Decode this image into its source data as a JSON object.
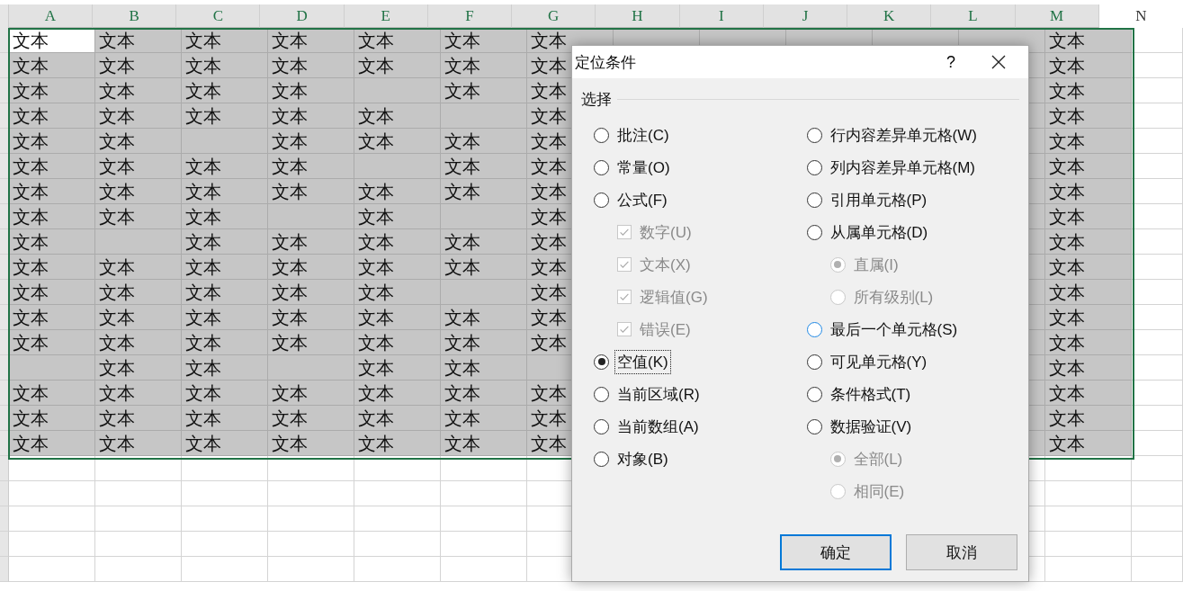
{
  "sheet": {
    "active_cell_at_origin": true,
    "columns": [
      {
        "label": "A",
        "selected": true
      },
      {
        "label": "B",
        "selected": true
      },
      {
        "label": "C",
        "selected": true
      },
      {
        "label": "D",
        "selected": true
      },
      {
        "label": "E",
        "selected": true
      },
      {
        "label": "F",
        "selected": true
      },
      {
        "label": "G",
        "selected": true
      },
      {
        "label": "H",
        "selected": true
      },
      {
        "label": "I",
        "selected": true
      },
      {
        "label": "J",
        "selected": true
      },
      {
        "label": "K",
        "selected": true
      },
      {
        "label": "L",
        "selected": true
      },
      {
        "label": "M",
        "selected": true
      },
      {
        "label": "N",
        "selected": false
      }
    ],
    "rows": [
      [
        "文本",
        "文本",
        "文本",
        "文本",
        "文本",
        "文本",
        "文本",
        null,
        null,
        null,
        null,
        null,
        "文本"
      ],
      [
        "文本",
        "文本",
        "文本",
        "文本",
        "文本",
        "文本",
        "文本",
        null,
        null,
        null,
        null,
        null,
        "文本"
      ],
      [
        "文本",
        "文本",
        "文本",
        "文本",
        null,
        "文本",
        "文本",
        null,
        null,
        null,
        null,
        null,
        "文本"
      ],
      [
        "文本",
        "文本",
        "文本",
        "文本",
        "文本",
        null,
        "文本",
        null,
        null,
        null,
        null,
        null,
        "文本"
      ],
      [
        "文本",
        "文本",
        null,
        "文本",
        "文本",
        "文本",
        "文本",
        null,
        null,
        null,
        null,
        null,
        "文本"
      ],
      [
        "文本",
        "文本",
        "文本",
        "文本",
        null,
        "文本",
        "文本",
        null,
        null,
        null,
        null,
        null,
        "文本"
      ],
      [
        "文本",
        "文本",
        "文本",
        "文本",
        "文本",
        "文本",
        "文本",
        null,
        null,
        null,
        null,
        null,
        "文本"
      ],
      [
        "文本",
        "文本",
        "文本",
        null,
        "文本",
        null,
        "文本",
        null,
        null,
        null,
        null,
        null,
        "文本"
      ],
      [
        "文本",
        null,
        "文本",
        "文本",
        "文本",
        "文本",
        "文本",
        null,
        null,
        null,
        null,
        null,
        "文本"
      ],
      [
        "文本",
        "文本",
        "文本",
        "文本",
        "文本",
        "文本",
        "文本",
        null,
        null,
        null,
        null,
        null,
        "文本"
      ],
      [
        "文本",
        "文本",
        "文本",
        "文本",
        "文本",
        null,
        "文本",
        null,
        null,
        null,
        null,
        null,
        "文本"
      ],
      [
        "文本",
        "文本",
        "文本",
        "文本",
        "文本",
        "文本",
        "文本",
        null,
        null,
        null,
        null,
        null,
        "文本"
      ],
      [
        "文本",
        "文本",
        "文本",
        "文本",
        "文本",
        "文本",
        "文本",
        null,
        null,
        null,
        null,
        null,
        "文本"
      ],
      [
        null,
        "文本",
        "文本",
        null,
        "文本",
        "文本",
        null,
        null,
        null,
        null,
        null,
        null,
        "文本"
      ],
      [
        "文本",
        "文本",
        "文本",
        "文本",
        "文本",
        "文本",
        "文本",
        null,
        null,
        null,
        null,
        null,
        "文本"
      ],
      [
        "文本",
        "文本",
        "文本",
        "文本",
        "文本",
        "文本",
        "文本",
        null,
        null,
        null,
        null,
        null,
        "文本"
      ],
      [
        "文本",
        "文本",
        "文本",
        "文本",
        "文本",
        "文本",
        "文本",
        null,
        null,
        null,
        null,
        null,
        "文本"
      ]
    ]
  },
  "dialog": {
    "title": "定位条件",
    "help": "?",
    "group_label": "选择",
    "left_options": [
      {
        "kind": "radio",
        "label": "批注(C)",
        "selected": false,
        "disabled": false,
        "focused": false,
        "hovered": false
      },
      {
        "kind": "radio",
        "label": "常量(O)",
        "selected": false,
        "disabled": false,
        "focused": false,
        "hovered": false
      },
      {
        "kind": "radio",
        "label": "公式(F)",
        "selected": false,
        "disabled": false,
        "focused": false,
        "hovered": false,
        "children": [
          {
            "kind": "checkbox",
            "label": "数字(U)",
            "checked": true,
            "disabled": true,
            "focused": false
          },
          {
            "kind": "checkbox",
            "label": "文本(X)",
            "checked": true,
            "disabled": true,
            "focused": false
          },
          {
            "kind": "checkbox",
            "label": "逻辑值(G)",
            "checked": true,
            "disabled": true,
            "focused": false
          },
          {
            "kind": "checkbox",
            "label": "错误(E)",
            "checked": true,
            "disabled": true,
            "focused": false
          }
        ]
      },
      {
        "kind": "radio",
        "label": "空值(K)",
        "selected": true,
        "disabled": false,
        "focused": true,
        "hovered": false
      },
      {
        "kind": "radio",
        "label": "当前区域(R)",
        "selected": false,
        "disabled": false,
        "focused": false,
        "hovered": false
      },
      {
        "kind": "radio",
        "label": "当前数组(A)",
        "selected": false,
        "disabled": false,
        "focused": false,
        "hovered": false
      },
      {
        "kind": "radio",
        "label": "对象(B)",
        "selected": false,
        "disabled": false,
        "focused": false,
        "hovered": false
      }
    ],
    "right_options": [
      {
        "kind": "radio",
        "label": "行内容差异单元格(W)",
        "selected": false,
        "disabled": false,
        "focused": false,
        "hovered": false
      },
      {
        "kind": "radio",
        "label": "列内容差异单元格(M)",
        "selected": false,
        "disabled": false,
        "focused": false,
        "hovered": false
      },
      {
        "kind": "radio",
        "label": "引用单元格(P)",
        "selected": false,
        "disabled": false,
        "focused": false,
        "hovered": false
      },
      {
        "kind": "radio",
        "label": "从属单元格(D)",
        "selected": false,
        "disabled": false,
        "focused": false,
        "hovered": false,
        "children": [
          {
            "kind": "radio",
            "label": "直属(I)",
            "selected": true,
            "disabled": true,
            "focused": false,
            "hovered": false
          },
          {
            "kind": "radio",
            "label": "所有级别(L)",
            "selected": false,
            "disabled": true,
            "focused": false,
            "hovered": false
          }
        ]
      },
      {
        "kind": "radio",
        "label": "最后一个单元格(S)",
        "selected": false,
        "disabled": false,
        "focused": false,
        "hovered": true
      },
      {
        "kind": "radio",
        "label": "可见单元格(Y)",
        "selected": false,
        "disabled": false,
        "focused": false,
        "hovered": false
      },
      {
        "kind": "radio",
        "label": "条件格式(T)",
        "selected": false,
        "disabled": false,
        "focused": false,
        "hovered": false
      },
      {
        "kind": "radio",
        "label": "数据验证(V)",
        "selected": false,
        "disabled": false,
        "focused": false,
        "hovered": false,
        "children": [
          {
            "kind": "radio",
            "label": "全部(L)",
            "selected": true,
            "disabled": true,
            "focused": false,
            "hovered": false
          },
          {
            "kind": "radio",
            "label": "相同(E)",
            "selected": false,
            "disabled": true,
            "focused": false,
            "hovered": false
          }
        ]
      }
    ],
    "buttons": [
      {
        "label": "确定",
        "default": true
      },
      {
        "label": "取消",
        "default": false
      }
    ]
  }
}
